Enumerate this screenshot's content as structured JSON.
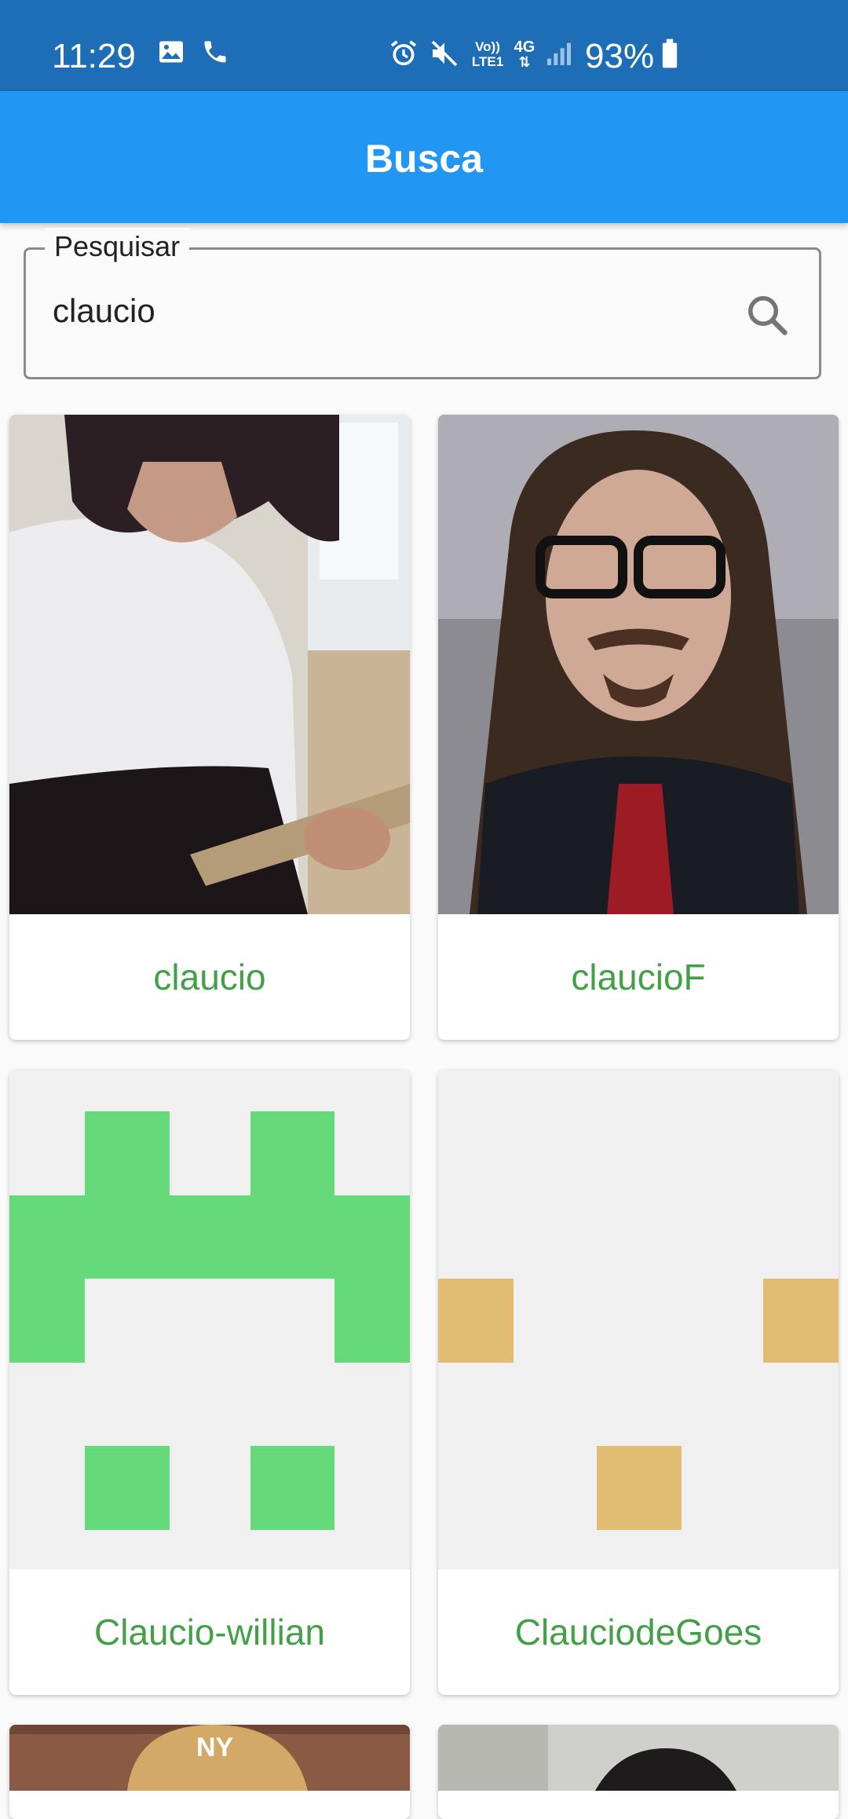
{
  "status_bar": {
    "time": "11:29",
    "battery_percent": "93%",
    "left_icons": [
      "image-icon",
      "phone-icon"
    ],
    "right_icons": [
      "alarm-icon",
      "mute-icon",
      "volte-icon",
      "4g-icon",
      "signal-icon",
      "battery-icon"
    ],
    "volte_text": "Vo)) LTE1",
    "network_text": "4G"
  },
  "app_bar": {
    "title": "Busca",
    "color": "#2196f3"
  },
  "search": {
    "label": "Pesquisar",
    "value": "claucio",
    "icon": "search-icon"
  },
  "results": [
    {
      "username": "claucio",
      "avatar": "photo"
    },
    {
      "username": "claucioF",
      "avatar": "photo"
    },
    {
      "username": "Claucio-willian",
      "avatar": "identicon",
      "color": "#66d97a"
    },
    {
      "username": "ClauciodeGoes",
      "avatar": "identicon",
      "color": "#e0bd73"
    },
    {
      "username": "",
      "avatar": "photo"
    },
    {
      "username": "",
      "avatar": "photo"
    }
  ],
  "colors": {
    "status_bar": "#1e6db7",
    "username_text": "#43a047",
    "identicon_background": "#f0f0f0"
  }
}
